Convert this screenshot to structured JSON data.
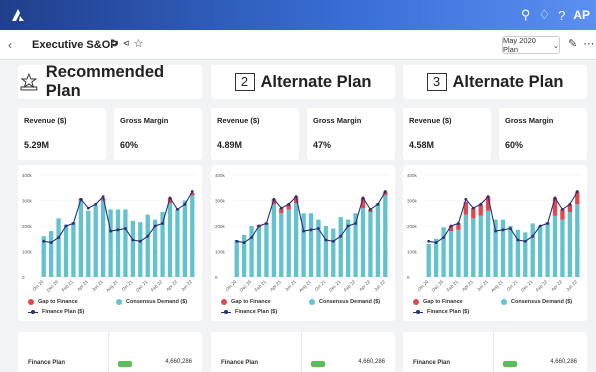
{
  "header": {
    "title": "Executive S&OP",
    "plan_select": "May 2020 Plan",
    "user_initials": "AP"
  },
  "columns": [
    {
      "title": "Recommended Plan",
      "number": "",
      "kpis": [
        {
          "label": "Revenue ($)",
          "value": "5.29M"
        },
        {
          "label": "Gross Margin",
          "value": "60%"
        }
      ],
      "bottom": {
        "label": "Finance Plan",
        "value": "4,660,286"
      }
    },
    {
      "title": "Alternate Plan",
      "number": "2",
      "kpis": [
        {
          "label": "Revenue ($)",
          "value": "4.89M"
        },
        {
          "label": "Gross Margin",
          "value": "47%"
        }
      ],
      "bottom": {
        "label": "Finance Plan",
        "value": "4,660,286"
      }
    },
    {
      "title": "Alternate Plan",
      "number": "3",
      "kpis": [
        {
          "label": "Revenue ($)",
          "value": "4.58M"
        },
        {
          "label": "Gross Margin",
          "value": "60%"
        }
      ],
      "bottom": {
        "label": "Finance Plan",
        "value": "4,660,286"
      }
    }
  ],
  "legend": {
    "gap": "Gap to Finance",
    "consensus": "Consensus Demand ($)",
    "finance": "Finance Plan ($)"
  },
  "colors": {
    "consensus": "#62c3cf",
    "gap": "#e0474f",
    "finance": "#2a2f7a"
  },
  "chart_data": [
    {
      "type": "bar",
      "categories": [
        "Oct 20",
        "Nov 20",
        "Dec 20",
        "Jan 21",
        "Feb 21",
        "Mar 21",
        "Apr 21",
        "May 21",
        "Jun 21",
        "Jul 21",
        "Aug 21",
        "Sep 21",
        "Oct 21",
        "Nov 21",
        "Dec 21",
        "Jan 22",
        "Feb 22",
        "Mar 22",
        "Apr 22",
        "May 22",
        "Jun 22"
      ],
      "tick_labels": [
        "Oct 20",
        "Dec 20",
        "Feb 21",
        "Apr 21",
        "Jun 21",
        "Aug 21",
        "Oct 21",
        "Dec 21",
        "Feb 22",
        "Apr 22",
        "Jun 22"
      ],
      "yticks": [
        "0",
        "100k",
        "200k",
        "300k",
        "400k"
      ],
      "ylim": [
        0,
        400000
      ],
      "series": [
        {
          "name": "Consensus Demand ($)",
          "values": [
            160000,
            180000,
            230000,
            205000,
            215000,
            300000,
            260000,
            280000,
            300000,
            265000,
            265000,
            265000,
            220000,
            215000,
            245000,
            225000,
            255000,
            290000,
            265000,
            300000,
            320000
          ]
        },
        {
          "name": "Gap to Finance",
          "values": [
            0,
            0,
            0,
            0,
            0,
            8000,
            0,
            0,
            10000,
            0,
            0,
            0,
            0,
            0,
            0,
            0,
            0,
            20000,
            0,
            0,
            10000
          ]
        },
        {
          "name": "Finance Plan ($)",
          "values": [
            140000,
            135000,
            155000,
            200000,
            210000,
            305000,
            270000,
            285000,
            315000,
            180000,
            185000,
            190000,
            145000,
            140000,
            160000,
            200000,
            210000,
            310000,
            265000,
            285000,
            335000
          ]
        }
      ]
    },
    {
      "type": "bar",
      "categories": [
        "Oct 20",
        "Nov 20",
        "Dec 20",
        "Jan 21",
        "Feb 21",
        "Mar 21",
        "Apr 21",
        "May 21",
        "Jun 21",
        "Jul 21",
        "Aug 21",
        "Sep 21",
        "Oct 21",
        "Nov 21",
        "Dec 21",
        "Jan 22",
        "Feb 22",
        "Mar 22",
        "Apr 22",
        "May 22",
        "Jun 22"
      ],
      "tick_labels": [
        "Oct 20",
        "Dec 20",
        "Feb 21",
        "Apr 21",
        "Jun 21",
        "Aug 21",
        "Oct 21",
        "Dec 21",
        "Feb 22",
        "Apr 22",
        "Jun 22"
      ],
      "yticks": [
        "0",
        "100k",
        "200k",
        "300k",
        "400k"
      ],
      "ylim": [
        0,
        400000
      ],
      "series": [
        {
          "name": "Consensus Demand ($)",
          "values": [
            145000,
            165000,
            200000,
            195000,
            205000,
            285000,
            250000,
            265000,
            290000,
            250000,
            250000,
            225000,
            200000,
            190000,
            235000,
            225000,
            250000,
            270000,
            255000,
            290000,
            320000
          ]
        },
        {
          "name": "Gap to Finance",
          "values": [
            0,
            0,
            0,
            10000,
            8000,
            20000,
            20000,
            20000,
            25000,
            0,
            0,
            0,
            0,
            0,
            0,
            0,
            0,
            40000,
            10000,
            0,
            15000
          ]
        },
        {
          "name": "Finance Plan ($)",
          "values": [
            140000,
            135000,
            155000,
            200000,
            210000,
            305000,
            270000,
            285000,
            315000,
            180000,
            185000,
            190000,
            145000,
            140000,
            160000,
            200000,
            210000,
            310000,
            265000,
            285000,
            335000
          ]
        }
      ]
    },
    {
      "type": "bar",
      "categories": [
        "Oct 20",
        "Nov 20",
        "Dec 20",
        "Jan 21",
        "Feb 21",
        "Mar 21",
        "Apr 21",
        "May 21",
        "Jun 21",
        "Jul 21",
        "Aug 21",
        "Sep 21",
        "Oct 21",
        "Nov 21",
        "Dec 21",
        "Jan 22",
        "Feb 22",
        "Mar 22",
        "Apr 22",
        "May 22",
        "Jun 22"
      ],
      "tick_labels": [
        "Oct 20",
        "Dec 20",
        "Feb 21",
        "Apr 21",
        "Jun 21",
        "Aug 21",
        "Oct 21",
        "Dec 21",
        "Feb 22",
        "Apr 22",
        "Jun 22"
      ],
      "yticks": [
        "0",
        "100k",
        "200k",
        "300k",
        "400k"
      ],
      "ylim": [
        0,
        400000
      ],
      "series": [
        {
          "name": "Consensus Demand ($)",
          "values": [
            130000,
            150000,
            195000,
            180000,
            185000,
            245000,
            230000,
            240000,
            260000,
            225000,
            225000,
            200000,
            185000,
            175000,
            210000,
            200000,
            215000,
            240000,
            225000,
            255000,
            285000
          ]
        },
        {
          "name": "Gap to Finance",
          "values": [
            0,
            0,
            0,
            20000,
            25000,
            50000,
            40000,
            45000,
            55000,
            0,
            0,
            0,
            0,
            0,
            0,
            0,
            0,
            70000,
            40000,
            30000,
            50000
          ]
        },
        {
          "name": "Finance Plan ($)",
          "values": [
            140000,
            135000,
            155000,
            200000,
            210000,
            305000,
            270000,
            285000,
            315000,
            180000,
            185000,
            190000,
            145000,
            140000,
            160000,
            200000,
            210000,
            310000,
            265000,
            285000,
            335000
          ]
        }
      ]
    }
  ]
}
